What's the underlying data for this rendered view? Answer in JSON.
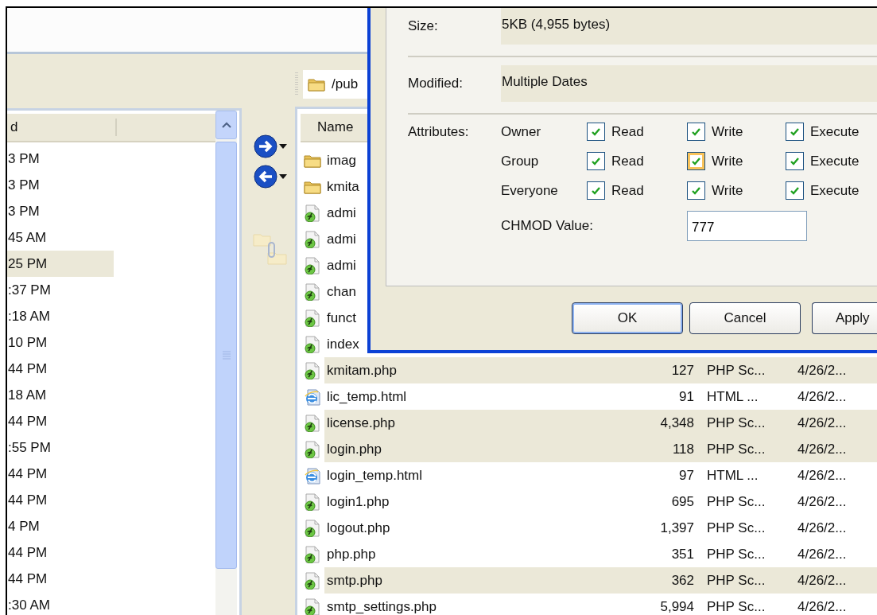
{
  "local_pane": {
    "columns": [
      "d"
    ],
    "rows": [
      {
        "text": "3 PM",
        "selected": false
      },
      {
        "text": "3 PM",
        "selected": false
      },
      {
        "text": "3 PM",
        "selected": false
      },
      {
        "text": "45 AM",
        "selected": false
      },
      {
        "text": "25 PM",
        "selected": true
      },
      {
        "text": ":37 PM",
        "selected": false
      },
      {
        "text": ":18 AM",
        "selected": false
      },
      {
        "text": "10 PM",
        "selected": false
      },
      {
        "text": "44 PM",
        "selected": false
      },
      {
        "text": "18 AM",
        "selected": false
      },
      {
        "text": "44 PM",
        "selected": false
      },
      {
        "text": ":55 PM",
        "selected": false
      },
      {
        "text": "44 PM",
        "selected": false
      },
      {
        "text": "44 PM",
        "selected": false
      },
      {
        "text": "4 PM",
        "selected": false
      },
      {
        "text": "44 PM",
        "selected": false
      },
      {
        "text": "44 PM",
        "selected": false
      },
      {
        "text": ":30 AM",
        "selected": false
      }
    ]
  },
  "remote_pane": {
    "path": "/pub",
    "columns": [
      "Name"
    ],
    "rows": [
      {
        "kind": "folder",
        "name": "imag",
        "selected": false
      },
      {
        "kind": "folder",
        "name": "kmita",
        "selected": false
      },
      {
        "kind": "php",
        "name": "admi",
        "selected": false
      },
      {
        "kind": "php",
        "name": "admi",
        "selected": false
      },
      {
        "kind": "php",
        "name": "admi",
        "selected": false
      },
      {
        "kind": "php",
        "name": "chan",
        "selected": false
      },
      {
        "kind": "php",
        "name": "funct",
        "selected": false
      },
      {
        "kind": "php",
        "name": "index",
        "selected": false
      },
      {
        "kind": "php",
        "name": "kmitam.php",
        "size": "127",
        "type": "PHP Sc...",
        "modified": "4/26/2...",
        "selected": true
      },
      {
        "kind": "html",
        "name": "lic_temp.html",
        "size": "91",
        "type": "HTML ...",
        "modified": "4/26/2...",
        "selected": false
      },
      {
        "kind": "php",
        "name": "license.php",
        "size": "4,348",
        "type": "PHP Sc...",
        "modified": "4/26/2...",
        "selected": true
      },
      {
        "kind": "php",
        "name": "login.php",
        "size": "118",
        "type": "PHP Sc...",
        "modified": "4/26/2...",
        "selected": true
      },
      {
        "kind": "html",
        "name": "login_temp.html",
        "size": "97",
        "type": "HTML ...",
        "modified": "4/26/2...",
        "selected": false
      },
      {
        "kind": "php",
        "name": "login1.php",
        "size": "695",
        "type": "PHP Sc...",
        "modified": "4/26/2...",
        "selected": false
      },
      {
        "kind": "php",
        "name": "logout.php",
        "size": "1,397",
        "type": "PHP Sc...",
        "modified": "4/26/2...",
        "selected": false
      },
      {
        "kind": "php",
        "name": "php.php",
        "size": "351",
        "type": "PHP Sc...",
        "modified": "4/26/2...",
        "selected": false
      },
      {
        "kind": "php",
        "name": "smtp.php",
        "size": "362",
        "type": "PHP Sc...",
        "modified": "4/26/2...",
        "selected": true
      },
      {
        "kind": "php",
        "name": "smtp_settings.php",
        "size": "5,994",
        "type": "PHP Sc...",
        "modified": "4/26/2...",
        "selected": false
      }
    ]
  },
  "properties_dialog": {
    "size_label": "Size:",
    "size_value": "5KB (4,955 bytes)",
    "modified_label": "Modified:",
    "modified_value": "Multiple Dates",
    "attributes_label": "Attributes:",
    "permissions": [
      {
        "role": "Owner",
        "options": [
          {
            "label": "Read",
            "checked": true,
            "hovered": false
          },
          {
            "label": "Write",
            "checked": true,
            "hovered": false
          },
          {
            "label": "Execute",
            "checked": true,
            "hovered": false
          }
        ]
      },
      {
        "role": "Group",
        "options": [
          {
            "label": "Read",
            "checked": true,
            "hovered": false
          },
          {
            "label": "Write",
            "checked": true,
            "hovered": true
          },
          {
            "label": "Execute",
            "checked": true,
            "hovered": false
          }
        ]
      },
      {
        "role": "Everyone",
        "options": [
          {
            "label": "Read",
            "checked": true,
            "hovered": false
          },
          {
            "label": "Write",
            "checked": true,
            "hovered": false
          },
          {
            "label": "Execute",
            "checked": true,
            "hovered": false
          }
        ]
      }
    ],
    "chmod_label": "CHMOD Value:",
    "chmod_value": "777",
    "buttons": [
      {
        "label": "OK",
        "default": true
      },
      {
        "label": "Cancel",
        "default": false
      },
      {
        "label": "Apply",
        "default": false
      }
    ]
  }
}
